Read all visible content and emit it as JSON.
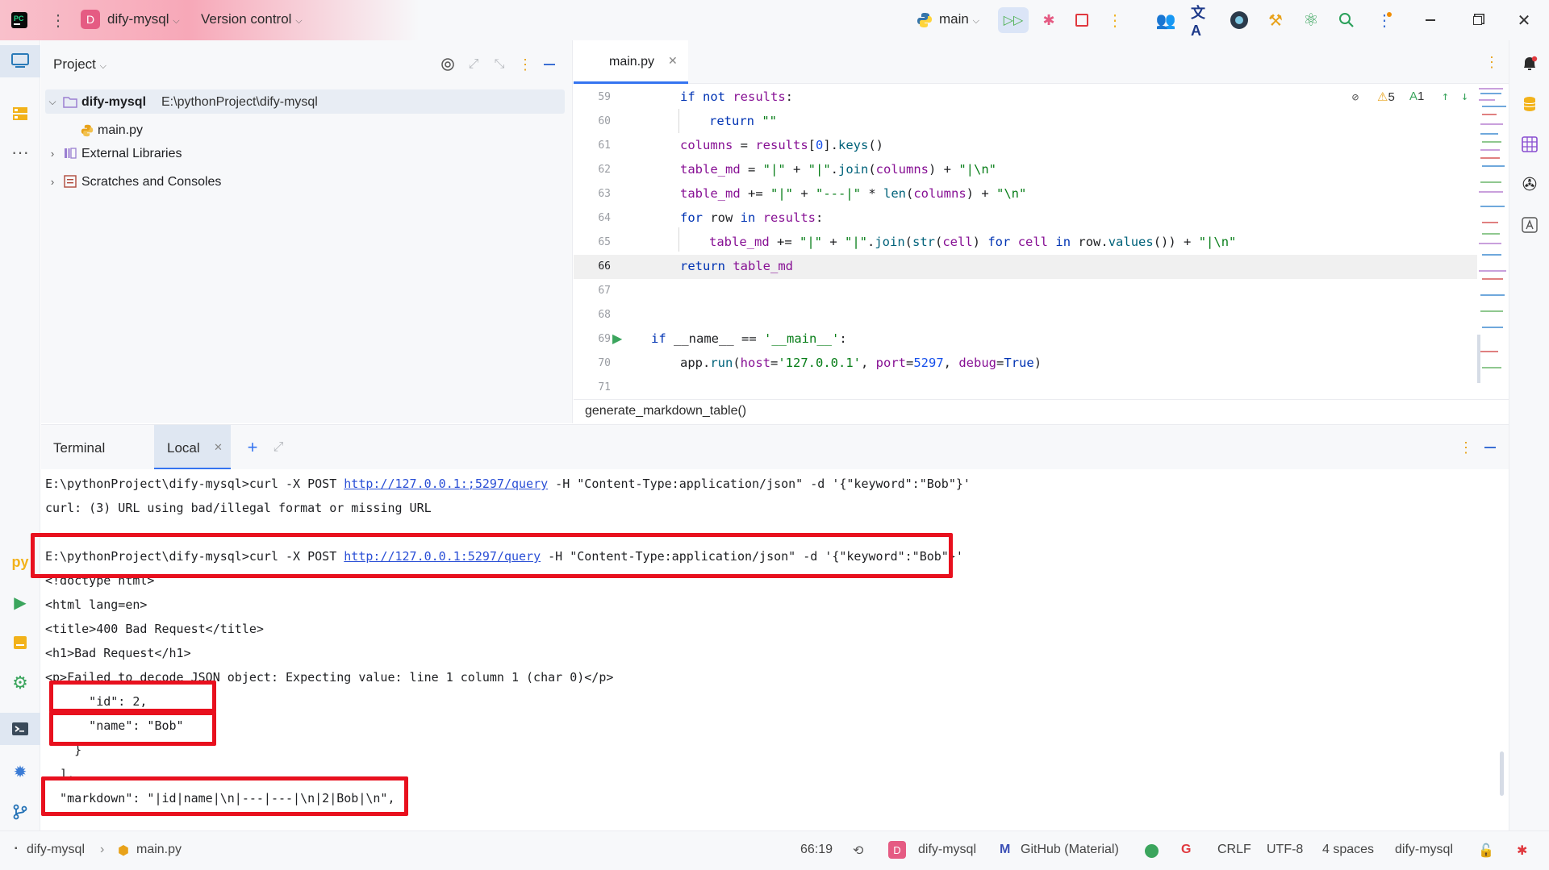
{
  "titlebar": {
    "project_initial": "D",
    "project_name": "dify-mysql",
    "vcs_label": "Version control",
    "branch": "main"
  },
  "project_panel": {
    "title": "Project",
    "root_name": "dify-mysql",
    "root_path": "E:\\pythonProject\\dify-mysql",
    "file": "main.py",
    "external_libraries": "External Libraries",
    "scratches": "Scratches and Consoles"
  },
  "editor": {
    "tab_label": "main.py",
    "warnings_count": "5",
    "typos_count": "1",
    "breadcrumb": "generate_markdown_table()",
    "current_line": "66",
    "line_numbers": [
      "59",
      "60",
      "61",
      "62",
      "63",
      "64",
      "65",
      "66",
      "67",
      "68",
      "69",
      "70",
      "71"
    ]
  },
  "terminal": {
    "tab_terminal": "Terminal",
    "tab_local": "Local",
    "lines": {
      "l1_prompt": "E:\\pythonProject\\dify-mysql>curl -X POST ",
      "l1_url": "http://127.0.0.1:;5297/query",
      "l1_rest": " -H \"Content-Type:application/json\" -d '{\"keyword\":\"Bob\"}'",
      "l2": "curl: (3) URL using bad/illegal format or missing URL",
      "l3_prompt": "E:\\pythonProject\\dify-mysql>curl -X POST ",
      "l3_url": "http://127.0.0.1:5297/query",
      "l3_rest": " -H \"Content-Type:application/json\" -d '{\"keyword\":\"Bob\"}'",
      "l4": "<!doctype html>",
      "l5": "<html lang=en>",
      "l6": "<title>400 Bad Request</title>",
      "l7": "<h1>Bad Request</h1>",
      "l8": "<p>Failed to decode JSON object: Expecting value: line 1 column 1 (char 0)</p>",
      "l9": "      \"id\": 2,",
      "l10": "      \"name\": \"Bob\"",
      "l11": "    }",
      "l12": "  ],",
      "l13": "  \"markdown\": \"|id|name|\\n|---|---|\\n|2|Bob|\\n\","
    }
  },
  "statusbar": {
    "crumb_project": "dify-mysql",
    "crumb_file": "main.py",
    "position": "66:19",
    "interpreter_initial": "D",
    "interpreter": "dify-mysql",
    "theme": "GitHub (Material)",
    "line_sep": "CRLF",
    "encoding": "UTF-8",
    "indent": "4 spaces",
    "env": "dify-mysql"
  }
}
